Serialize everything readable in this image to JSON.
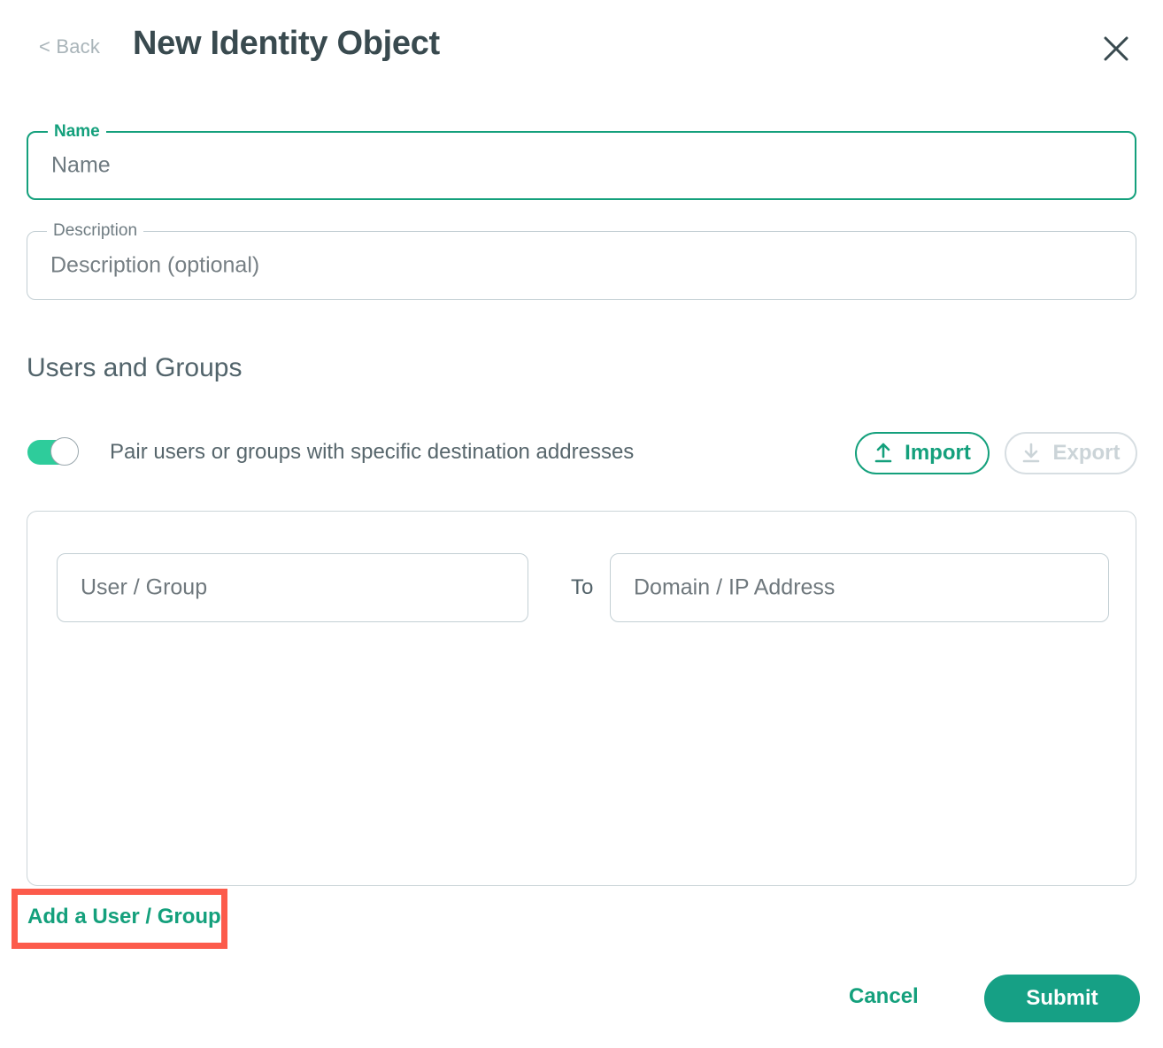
{
  "header": {
    "back_label": "< Back",
    "title": "New Identity Object",
    "close_icon": "close-icon"
  },
  "form": {
    "name_field": {
      "label": "Name",
      "placeholder": "Name",
      "focused": true,
      "accent_color": "#14a07c"
    },
    "description_field": {
      "label": "Description",
      "placeholder": "Description (optional)",
      "focused": false,
      "border_color": "#c2ced3"
    }
  },
  "section": {
    "title": "Users and Groups",
    "toggle": {
      "label": "Pair users or groups with specific destination addresses",
      "state": "on",
      "on_color": "#2ecc9b"
    },
    "import_button": {
      "label": "Import",
      "icon": "upload-icon",
      "enabled": true,
      "color": "#14a07c"
    },
    "export_button": {
      "label": "Export",
      "icon": "download-icon",
      "enabled": false,
      "color": "#cbd4d8"
    },
    "pairs": [
      {
        "user_group_placeholder": "User / Group",
        "separator_label": "To",
        "destination_placeholder": "Domain / IP Address"
      }
    ],
    "add_link": {
      "label": "Add a User / Group",
      "color": "#14a07c",
      "highlight_color": "#fc5b4b"
    }
  },
  "footer": {
    "cancel_label": "Cancel",
    "submit_label": "Submit",
    "submit_color": "#16a085"
  }
}
